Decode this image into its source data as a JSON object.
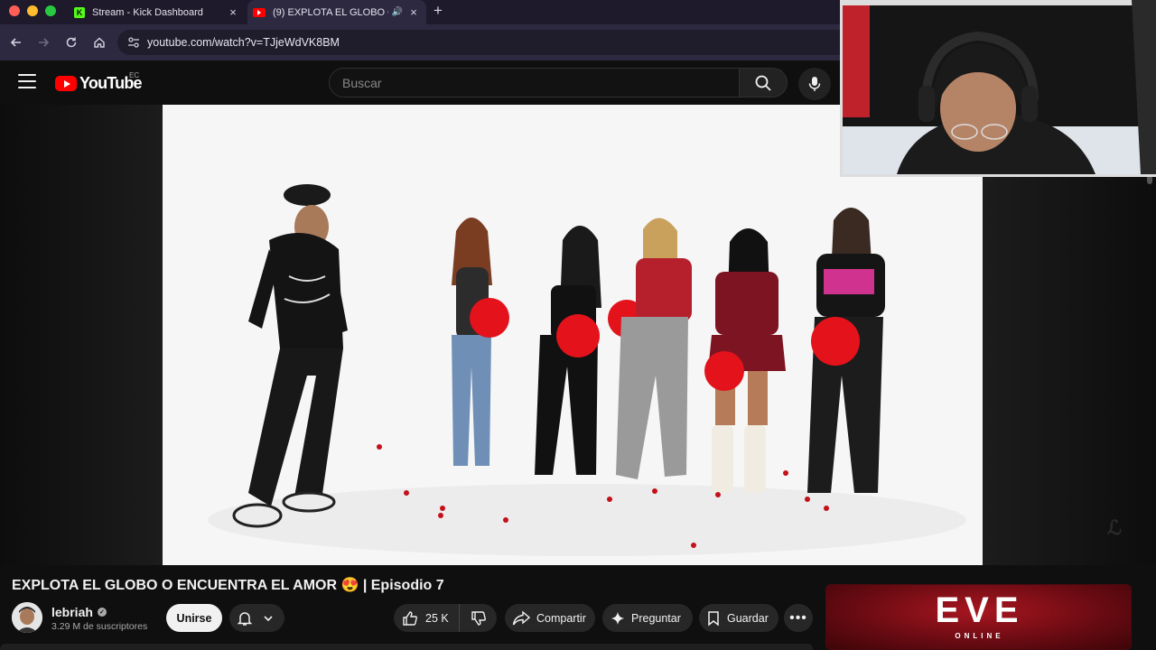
{
  "browser": {
    "tabs": [
      {
        "title": "Stream - Kick Dashboard",
        "favicon": "kick-logo-icon"
      },
      {
        "title": "(9) EXPLOTA EL GLOBO O",
        "favicon": "youtube-logo-icon",
        "audio": "🔊"
      }
    ],
    "close_symbol": "×",
    "new_tab_symbol": "+",
    "url": "youtube.com/watch?v=TJjeWdVK8BM"
  },
  "youtube": {
    "logo_text": "YouTube",
    "country_code": "EC",
    "search_placeholder": "Buscar"
  },
  "video": {
    "title": "EXPLOTA EL GLOBO O ENCUENTRA EL AMOR 😍 | Episodio 7"
  },
  "channel": {
    "name": "lebriah",
    "verified_mark": "✓",
    "subscribers": "3.29 M de suscriptores",
    "join_label": "Unirse"
  },
  "actions": {
    "likes": "25 K",
    "share_label": "Compartir",
    "ask_label": "Preguntar",
    "save_label": "Guardar",
    "more_label": "•••"
  },
  "ad": {
    "logo_text": "EVE",
    "subtitle": "ONLINE"
  },
  "colors": {
    "youtube_red": "#ff0000",
    "kick_green": "#53fc18",
    "balloon_red": "#e3121b"
  }
}
